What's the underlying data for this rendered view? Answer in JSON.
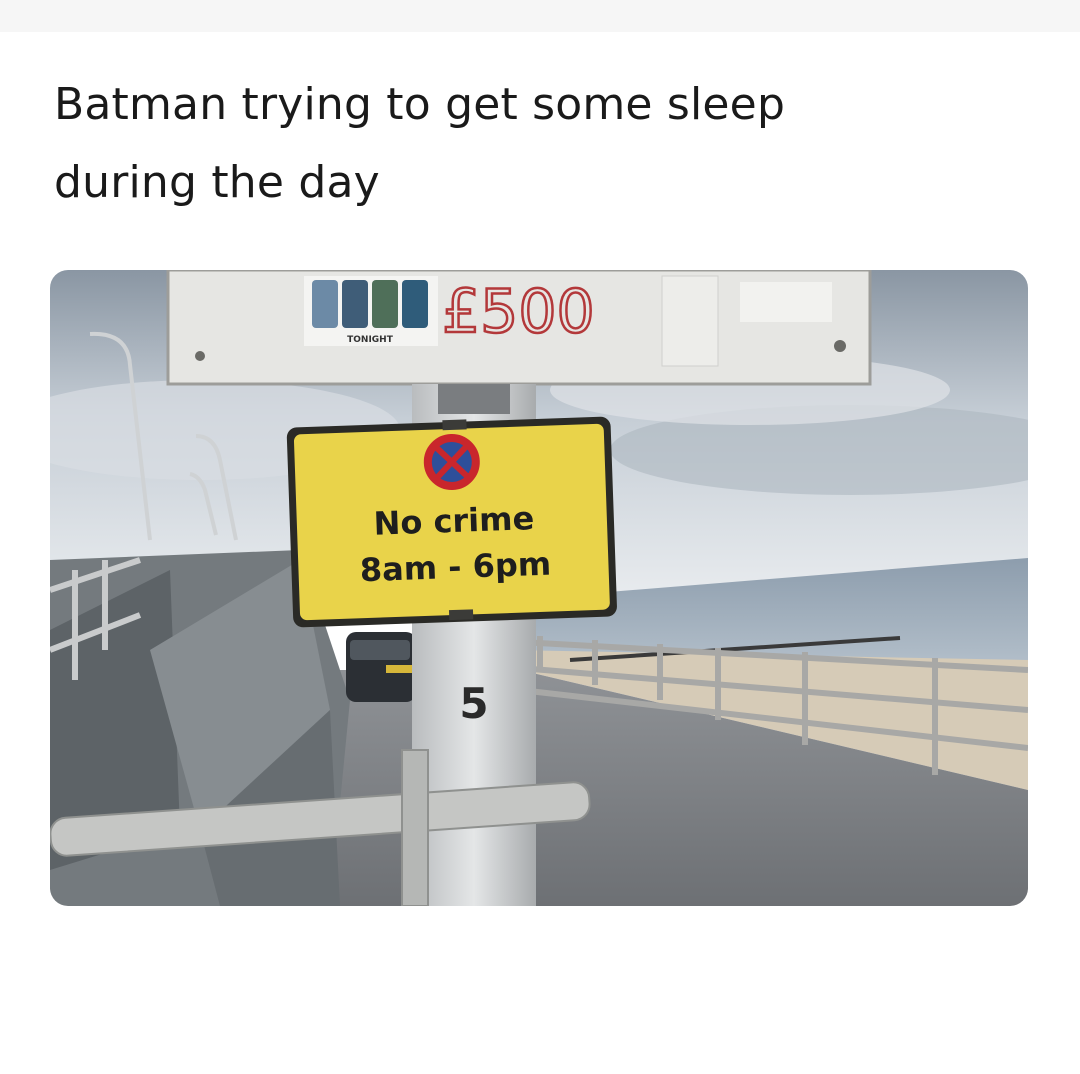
{
  "post": {
    "caption_line1": "Batman trying to get some sleep",
    "caption_line2": "during the day"
  },
  "photo": {
    "upper_sign_text": "£500",
    "sticker_text": "TONIGHT",
    "main_sign": {
      "line1": "No crime",
      "line2": "8am - 6pm",
      "background_color": "#e9d34a"
    },
    "post_number": "5"
  }
}
